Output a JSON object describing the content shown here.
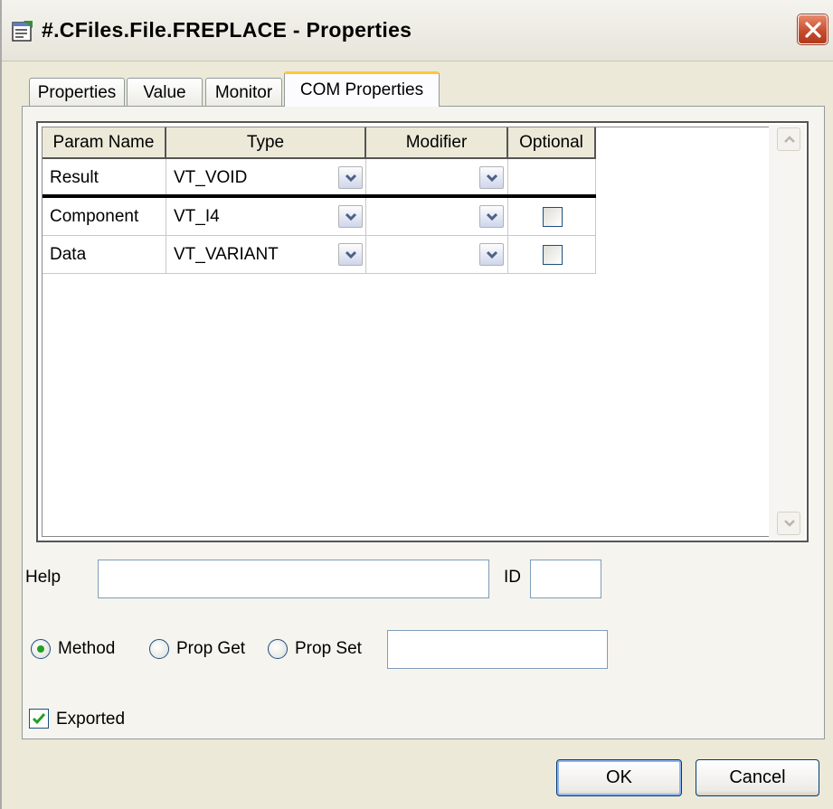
{
  "window": {
    "title": "#.CFiles.File.FREPLACE - Properties"
  },
  "tabs": [
    {
      "label": "Properties",
      "active": false
    },
    {
      "label": "Value",
      "active": false
    },
    {
      "label": "Monitor",
      "active": false
    },
    {
      "label": "COM Properties",
      "active": true
    }
  ],
  "grid": {
    "columns": [
      "Param Name",
      "Type",
      "Modifier",
      "Optional"
    ],
    "rows": [
      {
        "name": "Result",
        "type": "VT_VOID",
        "modifier": "",
        "optional_checkbox": false
      },
      {
        "name": "Component",
        "type": "VT_I4",
        "modifier": "",
        "optional_checkbox": true,
        "optional": false
      },
      {
        "name": "Data",
        "type": "VT_VARIANT",
        "modifier": "",
        "optional_checkbox": true,
        "optional": false
      }
    ]
  },
  "form": {
    "help_label": "Help",
    "help_value": "",
    "id_label": "ID",
    "id_value": "",
    "radio": {
      "options": [
        "Method",
        "Prop Get",
        "Prop Set"
      ],
      "selected": "Method"
    },
    "prop_value": "",
    "exported_label": "Exported",
    "exported": true
  },
  "buttons": {
    "ok": "OK",
    "cancel": "Cancel"
  },
  "colors": {
    "close_button": "#c44a2a",
    "active_tab_accent": "#ffc73c",
    "radio_dot": "#21a121",
    "check_mark": "#21a121"
  },
  "icons": {
    "app": "properties-document-icon",
    "close": "close-x-icon",
    "dropdown": "chevron-down-icon",
    "scroll_up": "arrow-up-icon",
    "scroll_down": "arrow-down-icon"
  }
}
